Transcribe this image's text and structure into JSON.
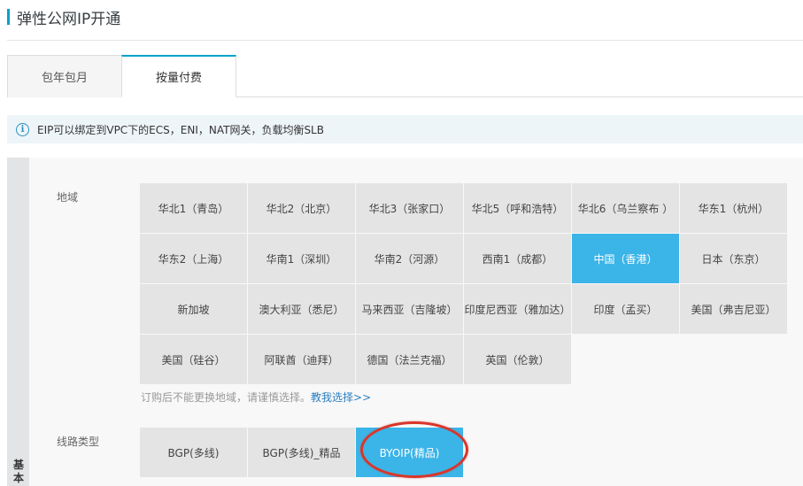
{
  "page": {
    "title": "弹性公网IP开通"
  },
  "tabs": [
    {
      "label": "包年包月",
      "active": false
    },
    {
      "label": "按量付费",
      "active": true
    }
  ],
  "notice": {
    "icon": "info-icon",
    "text": "EIP可以绑定到VPC下的ECS，ENI，NAT网关，负载均衡SLB"
  },
  "config": {
    "section_label": "基本",
    "region": {
      "label": "地域",
      "options": [
        "华北1（青岛）",
        "华北2（北京）",
        "华北3（张家口）",
        "华北5（呼和浩特）",
        "华北6（乌兰察布 ）",
        "华东1（杭州）",
        "华东2（上海）",
        "华南1（深圳）",
        "华南2（河源）",
        "西南1（成都）",
        "中国（香港）",
        "日本（东京）",
        "新加坡",
        "澳大利亚（悉尼）",
        "马来西亚（吉隆坡）",
        "印度尼西亚（雅加达）",
        "印度（孟买）",
        "美国（弗吉尼亚）",
        "美国（硅谷）",
        "阿联酋（迪拜）",
        "德国（法兰克福）",
        "英国（伦敦）"
      ],
      "selected": "中国（香港）",
      "tip": "订购后不能更换地域，请谨慎选择。",
      "tip_link": "教我选择>>"
    },
    "line_type": {
      "label": "线路类型",
      "options": [
        "BGP(多线)",
        "BGP(多线)_精品",
        "BYOIP(精品)"
      ],
      "selected": "BYOIP(精品)"
    }
  },
  "colors": {
    "accent": "#00a2ca",
    "selected_bg": "#3bb4e8",
    "annotation": "#d9362a",
    "link": "#2a7fc0"
  }
}
